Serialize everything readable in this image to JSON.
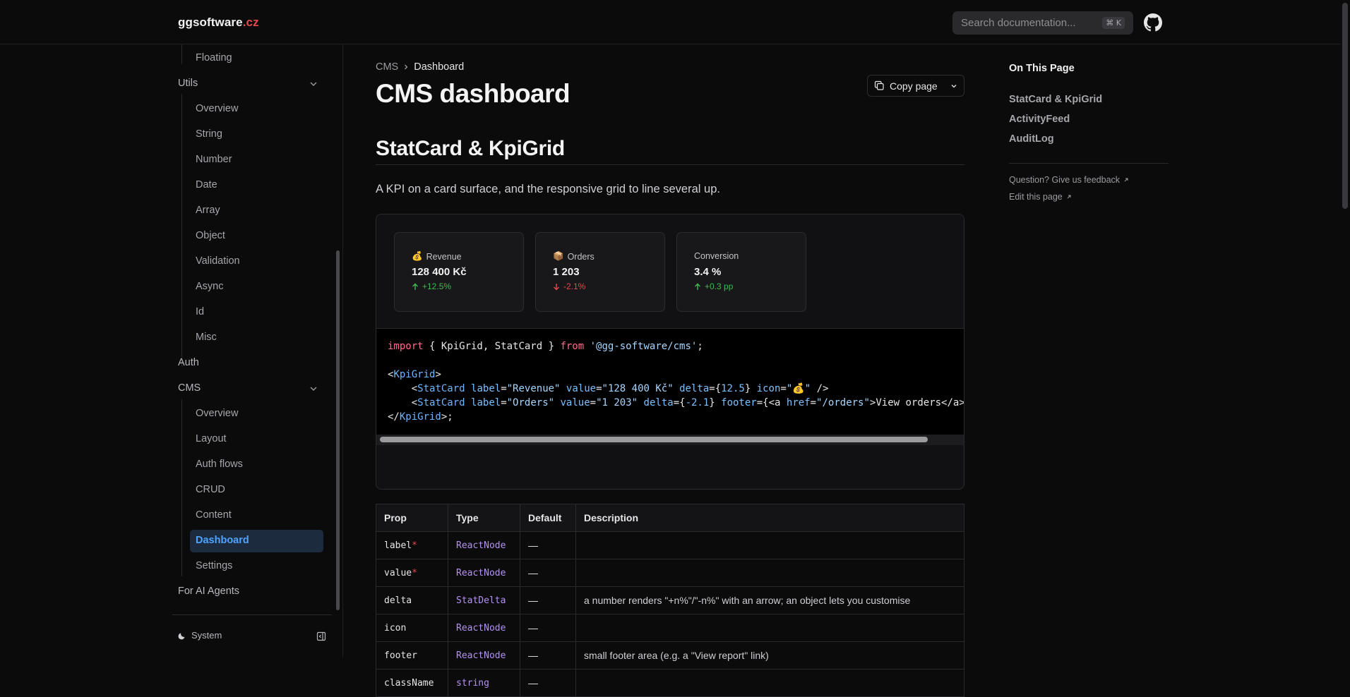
{
  "header": {
    "logo_name": "ggsoftware",
    "logo_tld": ".cz",
    "search_placeholder": "Search documentation...",
    "search_shortcut": "⌘ K"
  },
  "sidebar": {
    "items": [
      {
        "label": "Floating",
        "level": "sub"
      },
      {
        "label": "Utils",
        "level": "top",
        "expanded": true
      },
      {
        "label": "Overview",
        "level": "sub"
      },
      {
        "label": "String",
        "level": "sub"
      },
      {
        "label": "Number",
        "level": "sub"
      },
      {
        "label": "Date",
        "level": "sub"
      },
      {
        "label": "Array",
        "level": "sub"
      },
      {
        "label": "Object",
        "level": "sub"
      },
      {
        "label": "Validation",
        "level": "sub"
      },
      {
        "label": "Async",
        "level": "sub"
      },
      {
        "label": "Id",
        "level": "sub"
      },
      {
        "label": "Misc",
        "level": "sub"
      },
      {
        "label": "Auth",
        "level": "top"
      },
      {
        "label": "CMS",
        "level": "top",
        "expanded": true
      },
      {
        "label": "Overview",
        "level": "sub"
      },
      {
        "label": "Layout",
        "level": "sub"
      },
      {
        "label": "Auth flows",
        "level": "sub"
      },
      {
        "label": "CRUD",
        "level": "sub"
      },
      {
        "label": "Content",
        "level": "sub"
      },
      {
        "label": "Dashboard",
        "level": "sub",
        "active": true
      },
      {
        "label": "Settings",
        "level": "sub"
      },
      {
        "label": "For AI Agents",
        "level": "top"
      }
    ],
    "theme_label": "System"
  },
  "breadcrumb": {
    "parent": "CMS",
    "current": "Dashboard"
  },
  "page_title": "CMS dashboard",
  "copy_page_label": "Copy page",
  "section": {
    "title": "StatCard & KpiGrid",
    "lead": "A KPI on a card surface, and the responsive grid to line several up."
  },
  "stat_cards": [
    {
      "icon": "💰",
      "label": "Revenue",
      "value": "128 400 Kč",
      "delta": "+12.5%",
      "direction": "up"
    },
    {
      "icon": "📦",
      "label": "Orders",
      "value": "1 203",
      "delta": "-2.1%",
      "direction": "down"
    },
    {
      "icon": "",
      "label": "Conversion",
      "value": "3.4 %",
      "delta": "+0.3 pp",
      "direction": "up"
    }
  ],
  "code_lines": [
    "import { KpiGrid, StatCard } from '@gg-software/cms';",
    "",
    "<KpiGrid>",
    "    <StatCard label=\"Revenue\" value=\"128 400 Kč\" delta={12.5} icon=\"💰\" />",
    "    <StatCard label=\"Orders\" value=\"1 203\" delta={-2.1} footer={<a href=\"/orders\">View orders</a>",
    "</KpiGrid>;"
  ],
  "props_table": {
    "headers": [
      "Prop",
      "Type",
      "Default",
      "Description"
    ],
    "rows": [
      {
        "prop": "label",
        "required": true,
        "type": "ReactNode",
        "default": "—",
        "description": ""
      },
      {
        "prop": "value",
        "required": true,
        "type": "ReactNode",
        "default": "—",
        "description": ""
      },
      {
        "prop": "delta",
        "required": false,
        "type": "StatDelta",
        "default": "—",
        "description": "a number renders \"+n%\"/\"-n%\" with an arrow; an object lets you customise"
      },
      {
        "prop": "icon",
        "required": false,
        "type": "ReactNode",
        "default": "—",
        "description": ""
      },
      {
        "prop": "footer",
        "required": false,
        "type": "ReactNode",
        "default": "—",
        "description": "small footer area (e.g. a \"View report\" link)"
      },
      {
        "prop": "className",
        "required": false,
        "type": "string",
        "default": "—",
        "description": ""
      }
    ]
  },
  "toc": {
    "title": "On This Page",
    "links": [
      "StatCard & KpiGrid",
      "ActivityFeed",
      "AuditLog"
    ],
    "feedback_label": "Question? Give us feedback",
    "edit_label": "Edit this page"
  },
  "colors": {
    "accent": "#4fa3ff",
    "brand": "#e5484d",
    "up": "#3fb950",
    "down": "#e5484d"
  }
}
